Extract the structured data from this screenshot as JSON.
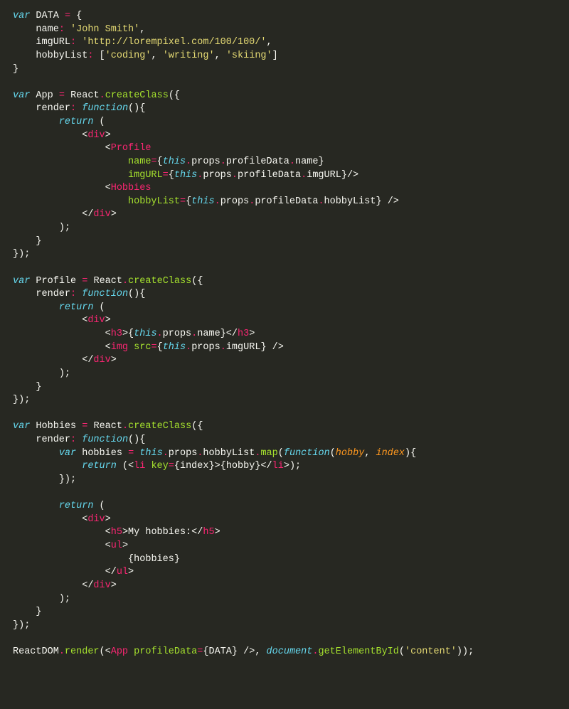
{
  "language": "javascript-jsx",
  "theme": "monokai",
  "code": {
    "data_obj": {
      "name": "John Smith",
      "imgURL": "http://lorempixel.com/100/100/",
      "hobbyList": [
        "coding",
        "writing",
        "skiing"
      ]
    },
    "components": [
      "App",
      "Profile",
      "Hobbies"
    ],
    "heading_text": "My hobbies:",
    "render_target": "content",
    "render_call": "ReactDOM.render(<App profileData={DATA} />, document.getElementById('content'));",
    "lines": [
      "var DATA = {",
      "    name: 'John Smith',",
      "    imgURL: 'http://lorempixel.com/100/100/',",
      "    hobbyList: ['coding', 'writing', 'skiing']",
      "}",
      "",
      "var App = React.createClass({",
      "    render: function(){",
      "        return (",
      "            <div>",
      "                <Profile",
      "                    name={this.props.profileData.name}",
      "                    imgURL={this.props.profileData.imgURL}/>",
      "                <Hobbies",
      "                    hobbyList={this.props.profileData.hobbyList} />",
      "            </div>",
      "        );",
      "    }",
      "});",
      "",
      "var Profile = React.createClass({",
      "    render: function(){",
      "        return (",
      "            <div>",
      "                <h3>{this.props.name}</h3>",
      "                <img src={this.props.imgURL} />",
      "            </div>",
      "        );",
      "    }",
      "});",
      "",
      "var Hobbies = React.createClass({",
      "    render: function(){",
      "        var hobbies = this.props.hobbyList.map(function(hobby, index){",
      "            return (<li key={index}>{hobby}</li>);",
      "        });",
      "",
      "        return (",
      "            <div>",
      "                <h5>My hobbies:</h5>",
      "                <ul>",
      "                    {hobbies}",
      "                </ul>",
      "            </div>",
      "        );",
      "    }",
      "});",
      "",
      "ReactDOM.render(<App profileData={DATA} />, document.getElementById('content'));"
    ]
  }
}
